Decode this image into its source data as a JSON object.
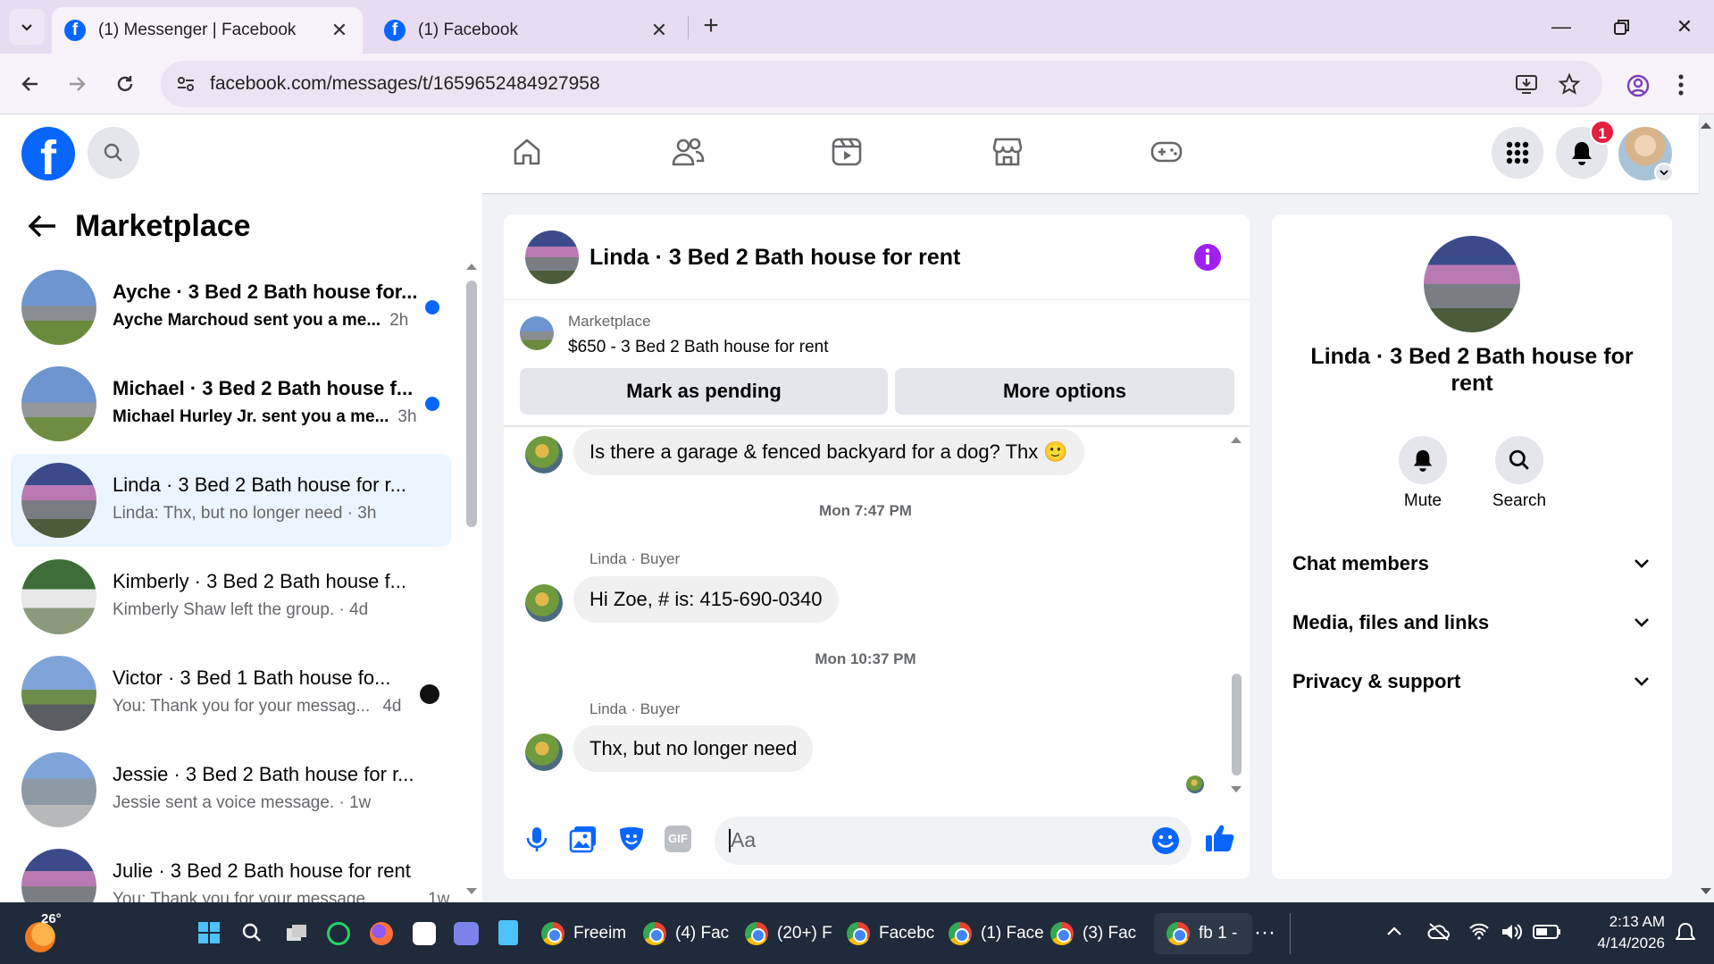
{
  "browser": {
    "tabs": [
      {
        "title": "(1) Messenger | Facebook",
        "favicon": "facebook-icon",
        "active": true
      },
      {
        "title": "(1) Facebook",
        "favicon": "facebook-icon",
        "active": false
      }
    ],
    "new_tab": "+",
    "url": "facebook.com/messages/t/1659652484927958"
  },
  "fb_header": {
    "notification_count": "1",
    "logo_letter": "f"
  },
  "sidebar": {
    "title": "Marketplace",
    "conversations": [
      {
        "name": "Ayche · 3 Bed 2 Bath house for...",
        "preview": "Ayche Marchoud sent you a me...",
        "time": "2h",
        "unread": true
      },
      {
        "name": "Michael · 3 Bed 2 Bath house f...",
        "preview": "Michael Hurley Jr. sent you a me...",
        "time": "3h",
        "unread": true
      },
      {
        "name": "Linda · 3 Bed 2 Bath house for r...",
        "preview": "Linda: Thx, but no longer need",
        "time": "3h",
        "unread": false
      },
      {
        "name": "Kimberly · 3 Bed 2 Bath house f...",
        "preview": "Kimberly Shaw left the group.",
        "time": "4d",
        "unread": false
      },
      {
        "name": "Victor · 3 Bed 1 Bath house fo...",
        "preview": "You: Thank you for your messag...",
        "time": "4d",
        "unread": false
      },
      {
        "name": "Jessie · 3 Bed 2 Bath house for r...",
        "preview": "Jessie sent a voice message.",
        "time": "1w",
        "unread": false
      },
      {
        "name": "Julie · 3 Bed 2 Bath house for rent",
        "preview": "You: Thank you for your message",
        "time": "1w",
        "unread": false
      }
    ]
  },
  "chat": {
    "title": "Linda · 3 Bed 2 Bath house for rent",
    "listing_label": "Marketplace",
    "listing_title": "$650 - 3 Bed 2 Bath house for rent",
    "mark_pending": "Mark as pending",
    "more_options": "More options",
    "messages": [
      {
        "text": "Is there a garage & fenced backyard for a dog? Thx 🙂"
      },
      {
        "timestamp": "Mon 7:47 PM"
      },
      {
        "sender": "Linda · Buyer",
        "text": "Hi Zoe, # is: 415-690-0340"
      },
      {
        "timestamp": "Mon 10:37 PM"
      },
      {
        "sender": "Linda · Buyer",
        "text": "Thx, but no longer need"
      }
    ],
    "composer_placeholder": "Aa"
  },
  "info_panel": {
    "title": "Linda · 3 Bed 2 Bath house for rent",
    "mute": "Mute",
    "search": "Search",
    "sections": [
      "Chat members",
      "Media, files and links",
      "Privacy & support"
    ]
  },
  "taskbar": {
    "weather": "26°",
    "apps": [
      "Freeim",
      "(4) Fac",
      "(20+) F",
      "Facebc",
      "(1) Face",
      "(3) Fac",
      "fb 1 - "
    ],
    "time": "2:13 AM",
    "date": "4/14/2026"
  },
  "colors": {
    "fb_blue": "#0866ff",
    "accent_purple": "#a020f0"
  }
}
